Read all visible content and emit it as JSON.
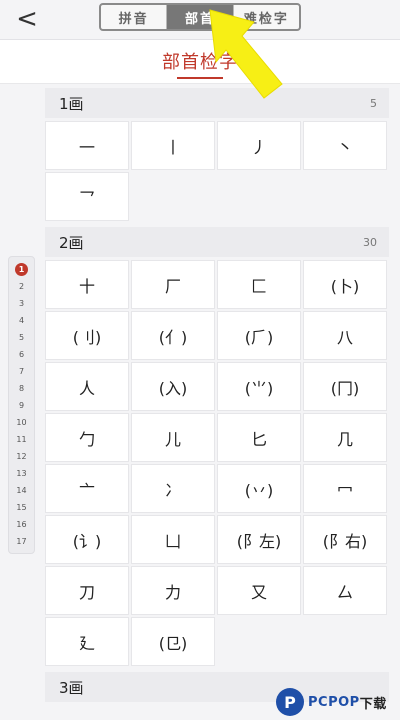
{
  "header": {
    "back_label": "<",
    "tabs": [
      {
        "label": "拼音",
        "active": false
      },
      {
        "label": "部首",
        "active": true
      },
      {
        "label": "难检字",
        "active": false
      }
    ]
  },
  "title": "部首检字",
  "index": [
    "1",
    "2",
    "3",
    "4",
    "5",
    "6",
    "7",
    "8",
    "9",
    "10",
    "11",
    "12",
    "13",
    "14",
    "15",
    "16",
    "17"
  ],
  "sections": [
    {
      "title": "1画",
      "count": "5",
      "items": [
        "一",
        "丨",
        "丿",
        "丶",
        "乛"
      ]
    },
    {
      "title": "2画",
      "count": "30",
      "items": [
        "十",
        "厂",
        "匚",
        "(卜)",
        "(刂)",
        "(亻)",
        "(⺁)",
        "八",
        "人",
        "(入)",
        "(⺌)",
        "(冂)",
        "勹",
        "儿",
        "匕",
        "几",
        "亠",
        "冫",
        "(丷)",
        "冖",
        "(讠)",
        "凵",
        "(阝左)",
        "(阝右)",
        "刀",
        "力",
        "又",
        "厶",
        "廴",
        "(㔾)"
      ]
    },
    {
      "title": "3画",
      "count": "",
      "items": []
    }
  ],
  "watermark": {
    "logo": "P",
    "brand": "PCPOP",
    "suffix": "下载"
  },
  "colors": {
    "accent": "#c0392b",
    "arrow": "#f7ef15"
  }
}
